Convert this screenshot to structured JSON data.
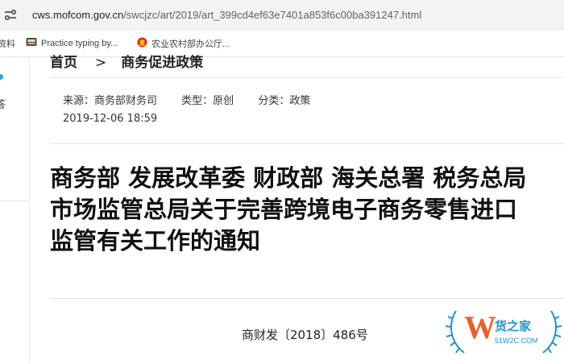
{
  "browser": {
    "url_domain": "cws.mofcom.gov.cn",
    "url_path": "/swcjzc/art/2019/art_399cd4ef63e7401a853f6c00ba391247.html"
  },
  "bookmarks": [
    {
      "label": "资料",
      "icon": "folder-icon"
    },
    {
      "label": "Practice typing by...",
      "icon": "keyboard-icon"
    },
    {
      "label": "农业农村部办公厅...",
      "icon": "emblem-icon"
    }
  ],
  "sidebar": {
    "partial_text": "答"
  },
  "breadcrumb": {
    "home": "首页",
    "separator": ">",
    "section": "商务促进政策"
  },
  "meta": {
    "source": "来源：商务部财务司",
    "type": "类型：原创",
    "category": "分类：政策",
    "date": "2019-12-06 18:59"
  },
  "article": {
    "title": "商务部 发展改革委 财政部 海关总署 税务总局 市场监管总局关于完善跨境电子商务零售进口监管有关工作的通知",
    "doc_number": "商财发〔2018〕486号"
  },
  "watermark": {
    "letter": "W",
    "name": "货之家",
    "site": "51W2C.COM",
    "colors": {
      "primary": "#1e93d2",
      "accent": "#e8612c"
    }
  }
}
